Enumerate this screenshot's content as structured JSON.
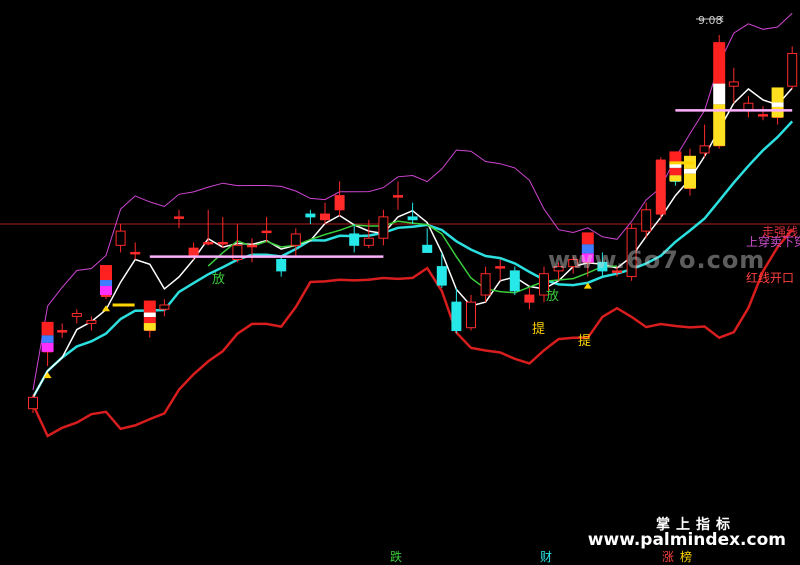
{
  "chart_data": {
    "type": "candlestick",
    "price_ylim": [
      6.3,
      9.2
    ],
    "candles": [
      {
        "o": 6.45,
        "h": 6.55,
        "l": 6.42,
        "c": 6.53,
        "k": "r"
      },
      {
        "o": 6.85,
        "h": 6.92,
        "l": 6.75,
        "c": 6.9,
        "k": "r"
      },
      {
        "o": 7.0,
        "h": 7.05,
        "l": 6.95,
        "c": 7.0,
        "k": "r"
      },
      {
        "o": 7.1,
        "h": 7.15,
        "l": 7.05,
        "c": 7.12,
        "k": "r"
      },
      {
        "o": 7.05,
        "h": 7.1,
        "l": 7.0,
        "c": 7.07,
        "k": "r"
      },
      {
        "o": 7.25,
        "h": 7.28,
        "l": 7.22,
        "c": 7.25,
        "k": "r"
      },
      {
        "o": 7.6,
        "h": 7.75,
        "l": 7.55,
        "c": 7.7,
        "k": "r"
      },
      {
        "o": 7.55,
        "h": 7.62,
        "l": 7.5,
        "c": 7.55,
        "k": "r"
      },
      {
        "o": 7.0,
        "h": 7.18,
        "l": 6.95,
        "c": 7.15,
        "k": "r"
      },
      {
        "o": 7.15,
        "h": 7.22,
        "l": 7.1,
        "c": 7.18,
        "k": "r"
      },
      {
        "o": 7.8,
        "h": 7.85,
        "l": 7.72,
        "c": 7.8,
        "k": "r"
      },
      {
        "o": 7.58,
        "h": 7.62,
        "l": 7.5,
        "c": 7.52,
        "k": "r"
      },
      {
        "o": 7.62,
        "h": 7.85,
        "l": 7.6,
        "c": 7.62,
        "k": "r"
      },
      {
        "o": 7.62,
        "h": 7.8,
        "l": 7.58,
        "c": 7.62,
        "k": "r"
      },
      {
        "o": 7.5,
        "h": 7.75,
        "l": 7.48,
        "c": 7.6,
        "k": "r"
      },
      {
        "o": 7.6,
        "h": 7.65,
        "l": 7.48,
        "c": 7.6,
        "k": "r"
      },
      {
        "o": 7.7,
        "h": 7.8,
        "l": 7.62,
        "c": 7.7,
        "k": "r"
      },
      {
        "o": 7.5,
        "h": 7.52,
        "l": 7.38,
        "c": 7.42,
        "k": "g"
      },
      {
        "o": 7.6,
        "h": 7.72,
        "l": 7.52,
        "c": 7.68,
        "k": "r"
      },
      {
        "o": 7.82,
        "h": 7.85,
        "l": 7.75,
        "c": 7.8,
        "k": "g"
      },
      {
        "o": 7.82,
        "h": 7.9,
        "l": 7.75,
        "c": 7.78,
        "k": "r"
      },
      {
        "o": 7.95,
        "h": 8.05,
        "l": 7.8,
        "c": 7.85,
        "k": "r"
      },
      {
        "o": 7.68,
        "h": 7.75,
        "l": 7.55,
        "c": 7.6,
        "k": "g"
      },
      {
        "o": 7.6,
        "h": 7.78,
        "l": 7.58,
        "c": 7.65,
        "k": "r"
      },
      {
        "o": 7.65,
        "h": 7.85,
        "l": 7.6,
        "c": 7.8,
        "k": "r"
      },
      {
        "o": 7.95,
        "h": 8.05,
        "l": 7.85,
        "c": 7.95,
        "k": "r"
      },
      {
        "o": 7.8,
        "h": 7.9,
        "l": 7.75,
        "c": 7.78,
        "k": "g"
      },
      {
        "o": 7.6,
        "h": 7.72,
        "l": 7.55,
        "c": 7.55,
        "k": "g"
      },
      {
        "o": 7.45,
        "h": 7.55,
        "l": 7.3,
        "c": 7.32,
        "k": "g"
      },
      {
        "o": 7.2,
        "h": 7.3,
        "l": 6.98,
        "c": 7.0,
        "k": "g"
      },
      {
        "o": 7.02,
        "h": 7.25,
        "l": 7.0,
        "c": 7.2,
        "k": "r"
      },
      {
        "o": 7.25,
        "h": 7.45,
        "l": 7.2,
        "c": 7.4,
        "k": "r"
      },
      {
        "o": 7.45,
        "h": 7.5,
        "l": 7.35,
        "c": 7.45,
        "k": "r"
      },
      {
        "o": 7.42,
        "h": 7.45,
        "l": 7.25,
        "c": 7.28,
        "k": "g"
      },
      {
        "o": 7.25,
        "h": 7.3,
        "l": 7.15,
        "c": 7.2,
        "k": "r"
      },
      {
        "o": 7.25,
        "h": 7.45,
        "l": 7.2,
        "c": 7.4,
        "k": "r"
      },
      {
        "o": 7.42,
        "h": 7.48,
        "l": 7.35,
        "c": 7.45,
        "k": "r"
      },
      {
        "o": 7.45,
        "h": 7.52,
        "l": 7.4,
        "c": 7.5,
        "k": "r"
      },
      {
        "o": 7.5,
        "h": 7.55,
        "l": 7.38,
        "c": 7.48,
        "k": "r"
      },
      {
        "o": 7.48,
        "h": 7.55,
        "l": 7.38,
        "c": 7.42,
        "k": "g"
      },
      {
        "o": 7.42,
        "h": 7.45,
        "l": 7.38,
        "c": 7.42,
        "k": "r"
      },
      {
        "o": 7.38,
        "h": 7.75,
        "l": 7.35,
        "c": 7.72,
        "k": "r"
      },
      {
        "o": 7.7,
        "h": 7.9,
        "l": 7.65,
        "c": 7.85,
        "k": "r"
      },
      {
        "o": 8.2,
        "h": 8.22,
        "l": 7.78,
        "c": 7.82,
        "k": "r"
      },
      {
        "o": 8.05,
        "h": 8.2,
        "l": 8.02,
        "c": 8.18,
        "k": "g"
      },
      {
        "o": 8.0,
        "h": 8.28,
        "l": 7.95,
        "c": 8.2,
        "k": "r"
      },
      {
        "o": 8.25,
        "h": 8.45,
        "l": 8.22,
        "c": 8.3,
        "k": "r"
      },
      {
        "o": 8.3,
        "h": 9.08,
        "l": 8.28,
        "c": 8.75,
        "k": "r"
      },
      {
        "o": 8.72,
        "h": 8.85,
        "l": 8.6,
        "c": 8.75,
        "k": "r"
      },
      {
        "o": 8.55,
        "h": 8.65,
        "l": 8.5,
        "c": 8.6,
        "k": "r"
      },
      {
        "o": 8.52,
        "h": 8.58,
        "l": 8.48,
        "c": 8.52,
        "k": "r"
      },
      {
        "o": 8.5,
        "h": 8.7,
        "l": 8.45,
        "c": 8.65,
        "k": "r"
      },
      {
        "o": 8.72,
        "h": 9.0,
        "l": 8.7,
        "c": 8.95,
        "k": "r"
      }
    ],
    "annotations": {
      "high_label": "9.08",
      "line_labels": [
        "走强线",
        "上穿卖下穿",
        "红线开口"
      ],
      "signal_fang": "放",
      "signal_ti": "提",
      "footer_marks": [
        "跌",
        "财",
        "涨",
        "榜"
      ]
    },
    "colors": {
      "rise": "#ff2a2a",
      "fall": "#27e8e8",
      "upper_band": "#cf45d3",
      "lower_band": "#d71d1d",
      "mid_line": "#2ce0e0",
      "fast_line": "#ffffff",
      "inner_line": "#3ccd3c",
      "hline": "#b41e1e"
    }
  },
  "watermark": {
    "title": "掌上指标",
    "url": "www.palmindex.com",
    "middle": "www.6o7o.com"
  }
}
